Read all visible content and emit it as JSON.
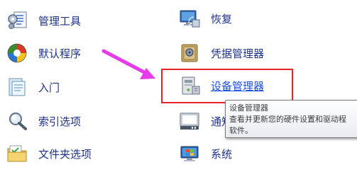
{
  "colors": {
    "link_text": "#1e3287",
    "hover_text": "#1c4ee0",
    "highlight": "#e8232a",
    "arrow": "#e63be8"
  },
  "left_column": [
    {
      "label": "管理工具",
      "icon": "admin-tools-icon"
    },
    {
      "label": "默认程序",
      "icon": "default-programs-icon"
    },
    {
      "label": "入门",
      "icon": "getting-started-icon"
    },
    {
      "label": "索引选项",
      "icon": "indexing-options-icon"
    },
    {
      "label": "文件夹选项",
      "icon": "folder-options-icon"
    }
  ],
  "right_column": [
    {
      "label": "恢复",
      "icon": "recovery-icon"
    },
    {
      "label": "凭据管理器",
      "icon": "credential-manager-icon"
    },
    {
      "label": "设备管理器",
      "icon": "device-manager-icon"
    },
    {
      "label": "通知",
      "icon": "notification-area-icon"
    },
    {
      "label": "系统",
      "icon": "system-icon"
    }
  ],
  "tooltip": {
    "title": "设备管理器",
    "line1": "查看并更新您的硬件设置和驱动程",
    "line2": "软件。"
  }
}
